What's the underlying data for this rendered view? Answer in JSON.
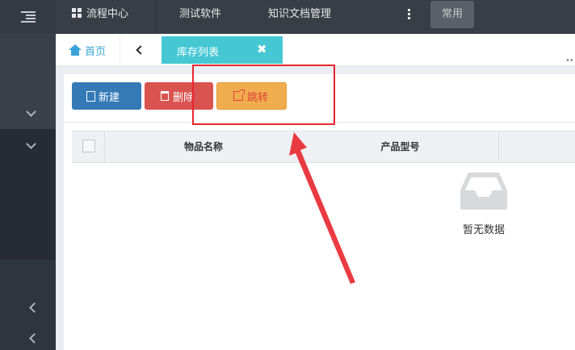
{
  "topnav": {
    "items": [
      {
        "label": "流程中心"
      },
      {
        "label": "测试软件"
      },
      {
        "label": "知识文档管理"
      }
    ],
    "common_button": "常用"
  },
  "tabs": {
    "home_label": "首页",
    "active_label": "库存列表",
    "close_glyph": "✖"
  },
  "toolbar": {
    "new_label": "新建",
    "delete_label": "删除",
    "jump_label": "跳转"
  },
  "table": {
    "columns": [
      "物品名称",
      "产品型号"
    ],
    "empty_text": "暂无数据"
  },
  "colors": {
    "primary": "#337ab7",
    "danger": "#d9534f",
    "warning": "#f0ad4e",
    "tab_active": "#45c8d4",
    "annotation": "#e8262d"
  }
}
